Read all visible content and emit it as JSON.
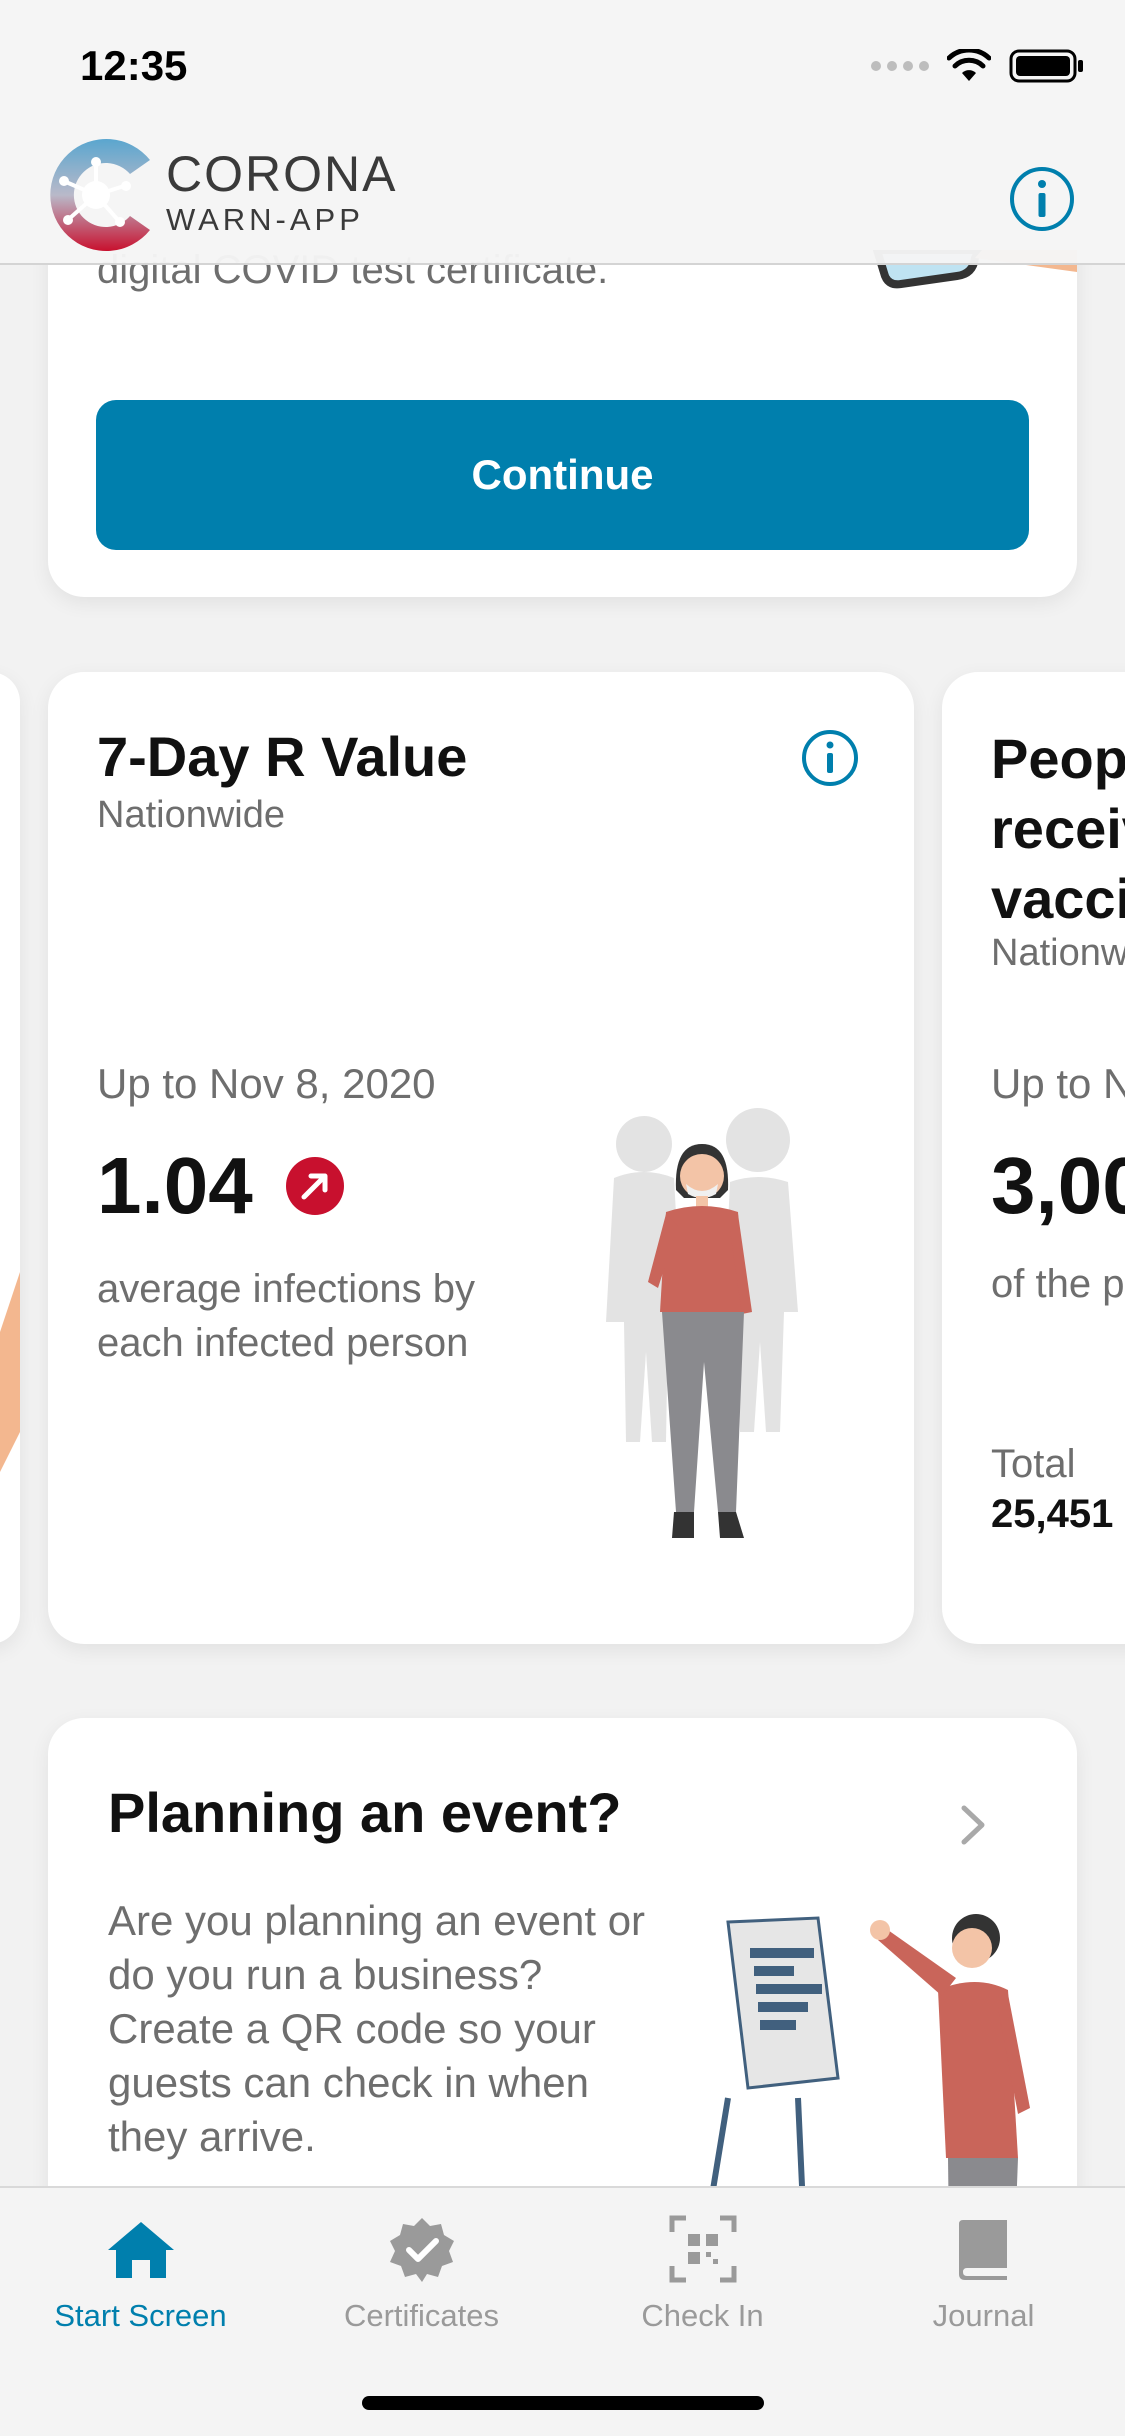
{
  "status_bar": {
    "time": "12:35"
  },
  "header": {
    "brand_main": "CORONA",
    "brand_sub": "WARN-APP"
  },
  "test_card": {
    "body": "digital COVID test certificate.",
    "continue_label": "Continue",
    "accent": "#007fad"
  },
  "stats": {
    "r_value": {
      "title": "7-Day R Value",
      "subtitle": "Nationwide",
      "date": "Up to Nov 8, 2020",
      "value": "1.04",
      "trend": "up",
      "description": "average infections by each infected person"
    },
    "vaccination_peek": {
      "title": "People receiving vaccination",
      "subtitle": "Nationwide",
      "date": "Up to N",
      "value": "3,00",
      "description": "of the p",
      "total_label": "Total",
      "total_value": "25,451"
    }
  },
  "event_card": {
    "title": "Planning an event?",
    "body": "Are you planning an event or do you run a business? Create a QR code so your guests can check in when they arrive."
  },
  "tab_bar": {
    "tabs": [
      {
        "label": "Start Screen",
        "icon": "home-icon",
        "active": true
      },
      {
        "label": "Certificates",
        "icon": "certificate-badge-icon",
        "active": false
      },
      {
        "label": "Check In",
        "icon": "qr-scan-icon",
        "active": false
      },
      {
        "label": "Journal",
        "icon": "book-icon",
        "active": false
      }
    ]
  },
  "colors": {
    "accent": "#007fad",
    "trend_up": "#c8102e",
    "text_secondary": "#6e6e6e"
  }
}
